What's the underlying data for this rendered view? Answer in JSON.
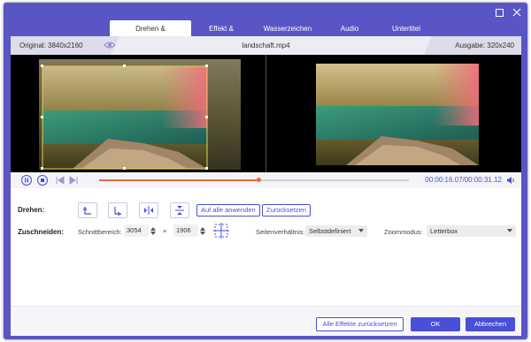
{
  "tabs": [
    {
      "label": "Drehen & Zuschneiden",
      "active": true
    },
    {
      "label": "Effekt & Filter",
      "active": false
    },
    {
      "label": "Wasserzeichen",
      "active": false
    },
    {
      "label": "Audio",
      "active": false
    },
    {
      "label": "Untertitel",
      "active": false
    }
  ],
  "info": {
    "original": "Original: 3840x2160",
    "filename": "landschaft.mp4",
    "output": "Ausgabe: 320x240"
  },
  "player": {
    "time": "00:00:16.07/00:00:31.12",
    "progress_fraction": 0.516
  },
  "rotate": {
    "label": "Drehen:",
    "apply_all": "Auf alle anwenden",
    "reset": "Zurücksetzen"
  },
  "crop": {
    "label": "Zuschneiden:",
    "area_label": "Schnittbereich:",
    "width": "3054",
    "times": "×",
    "height": "1906",
    "aspect_label": "Seitenverhältnis:",
    "aspect_value": "Selbstdefiniert",
    "zoom_label": "Zoommodus:",
    "zoom_value": "Letterbox"
  },
  "footer": {
    "reset_all": "Alle Effekte zurücksetzen",
    "ok": "OK",
    "cancel": "Abbrechen"
  },
  "colors": {
    "accent": "#4a4fd8",
    "frame": "#5a55c4",
    "progress": "#f0643c"
  }
}
